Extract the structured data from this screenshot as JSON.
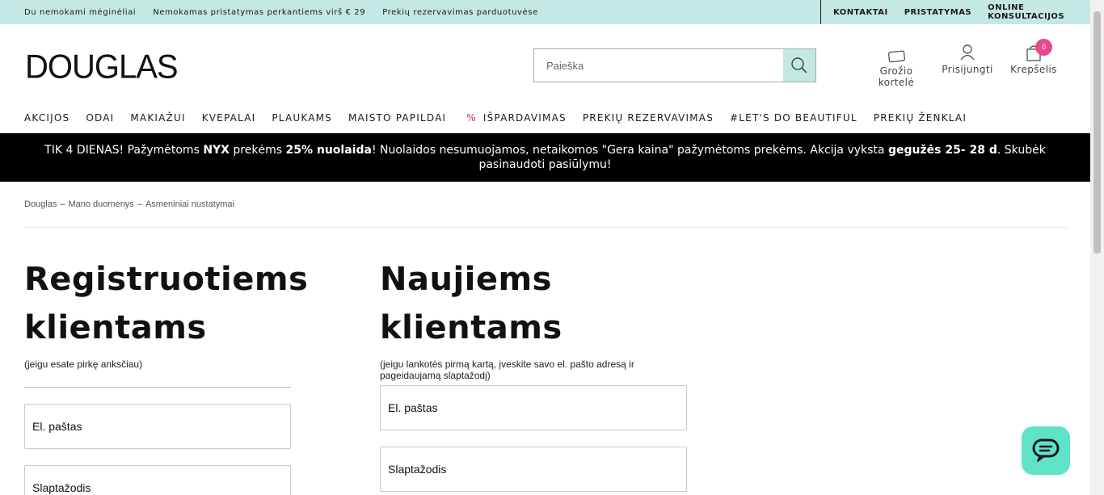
{
  "topbar": {
    "left": [
      "Du nemokami mėginėliai",
      "Nemokamas pristatymas perkantiems virš € 29",
      "Prekių rezervavimas parduotuvėse"
    ],
    "right": [
      "KONTAKTAI",
      "PRISTATYMAS",
      "ONLINE KONSULTACIJOS"
    ]
  },
  "header": {
    "logo": "DOUGLAS",
    "search_placeholder": "Paieška",
    "beauty_card": {
      "line1": "Grožio",
      "line2": "kortelė"
    },
    "login": "Prisijungti",
    "cart": {
      "label": "Krepšelis",
      "count": "0"
    }
  },
  "nav": {
    "items": [
      "AKCIJOS",
      "ODAI",
      "MAKIAŽUI",
      "KVEPALAI",
      "PLAUKAMS",
      "MAISTO PAPILDAI",
      "IŠPARDAVIMAS",
      "PREKIŲ REZERVAVIMAS",
      "#LET'S DO BEAUTIFUL",
      "PREKIŲ ŽENKLAI"
    ],
    "sale_prefix": "%"
  },
  "promo": {
    "t1": "TIK 4 DIENAS! Pažymėtoms ",
    "b1": "NYX",
    "t2": " prekėms ",
    "b2": "25% nuolaida",
    "t3": "! Nuolaidos nesumuojamos, netaikomos \"Gera kaina\" pažymėtoms prekėms. Akcija vyksta ",
    "b3": "gegužės 25- 28 d",
    "t4": ". Skubėk pasinaudoti pasiūlymu!"
  },
  "breadcrumb": [
    "Douglas",
    "Mano duomenys",
    "Asmeniniai nustatymai"
  ],
  "registered": {
    "title_line1": "Registruotiems",
    "title_line2": "klientams",
    "subtitle": "(jeigu esate pirkę anksčiau)",
    "email_placeholder": "El. paštas",
    "password_placeholder": "Slaptažodis"
  },
  "new_clients": {
    "title_line1": "Naujiems",
    "title_line2": "klientams",
    "subtitle": "(jeigu lankotės pirmą kartą, įveskite savo el. pašto adresą ir pageidaujamą slaptažodį)",
    "email_placeholder": "El. paštas",
    "password_placeholder": "Slaptažodis"
  },
  "colors": {
    "mint": "#c4e8e4",
    "badge": "#e8488f",
    "chat": "#5ee3c9",
    "sale": "#d0246a"
  }
}
